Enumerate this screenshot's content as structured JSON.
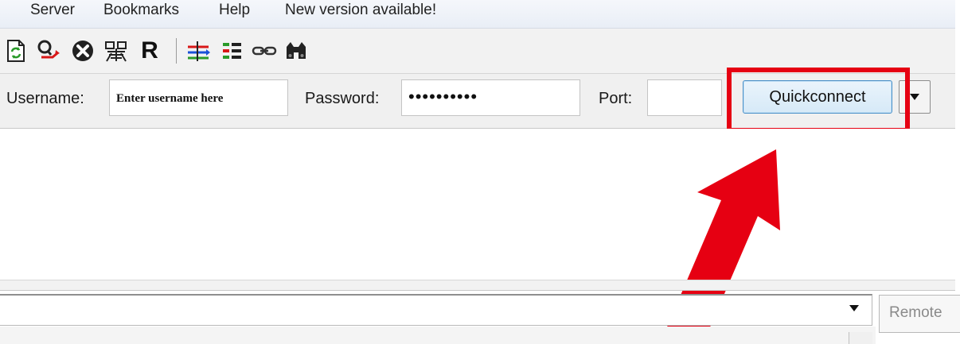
{
  "menu": {
    "items": [
      "Server",
      "Bookmarks",
      "Help",
      "New version available!"
    ]
  },
  "toolbar": {
    "icons": [
      "refresh-icon",
      "search-process-queue-icon",
      "cancel-icon",
      "disconnect-icon",
      "reconnect-icon",
      "compare-directories-icon",
      "filter-icon",
      "synchronized-browsing-icon",
      "find-files-icon"
    ],
    "reconnect_glyph": "R"
  },
  "quickconnect": {
    "username_label": "Username:",
    "username_placeholder": "Enter username here",
    "password_label": "Password:",
    "password_value": "••••••••••",
    "port_label": "Port:",
    "port_value": "",
    "button_label": "Quickconnect",
    "dropdown_icon": "triangle-down-icon"
  },
  "colors": {
    "highlight": "#e60012",
    "button_border": "#4a90c8"
  },
  "remote_site": {
    "label": "Remote"
  }
}
